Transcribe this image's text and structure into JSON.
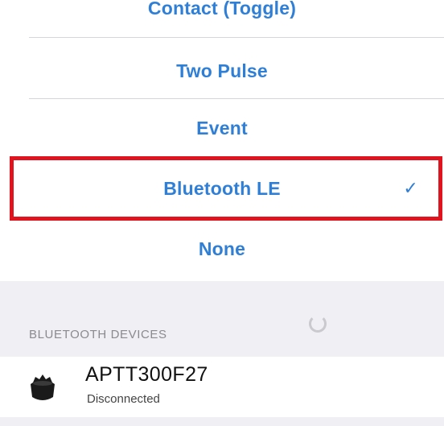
{
  "options": {
    "items": [
      {
        "label": "Contact (Toggle)"
      },
      {
        "label": "Two Pulse"
      },
      {
        "label": "Event"
      },
      {
        "label": "Bluetooth LE",
        "selected": true
      },
      {
        "label": "None"
      }
    ],
    "checkmark": "✓"
  },
  "bluetooth": {
    "section_header": "BLUETOOTH DEVICES",
    "devices": [
      {
        "name": "APTT300F27",
        "status": "Disconnected",
        "icon": "device-icon"
      }
    ]
  },
  "colors": {
    "accent": "#2f7fd6",
    "highlight": "#e0141e",
    "group_background": "#efeff4"
  }
}
